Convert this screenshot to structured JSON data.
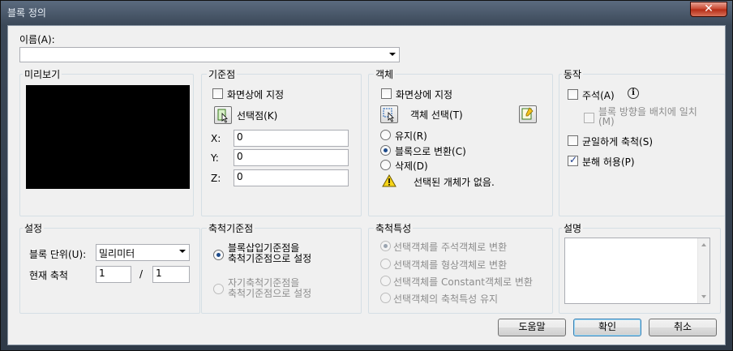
{
  "window": {
    "title": "블록 정의",
    "close_glyph": "✕"
  },
  "name": {
    "label": "이름(A):",
    "value": ""
  },
  "preview": {
    "title": "미리보기"
  },
  "base_point": {
    "title": "기준점",
    "specify_on_screen": "화면상에 지정",
    "pick_point": "선택점(K)",
    "x_label": "X:",
    "x_value": "0",
    "y_label": "Y:",
    "y_value": "0",
    "z_label": "Z:",
    "z_value": "0"
  },
  "objects": {
    "title": "객체",
    "specify_on_screen": "화면상에 지정",
    "select_objects": "객체 선택(T)",
    "retain": "유지(R)",
    "convert_to_block": "블록으로 변환(C)",
    "delete": "삭제(D)",
    "status": "선택된 개체가 없음."
  },
  "behavior": {
    "title": "동작",
    "annotative": "주석(A)",
    "match_orientation": "블록 방향을 배치에 일치",
    "match_orientation_suffix": "(M)",
    "scale_uniformly": "균일하게 축척(S)",
    "allow_exploding": "분해 허용(P)",
    "info_glyph": "i"
  },
  "settings": {
    "title": "설정",
    "block_unit_label": "블록 단위(U):",
    "block_unit_value": "밀리미터",
    "current_scale_label": "현재 축척",
    "scale_a": "1",
    "scale_sep": "/",
    "scale_b": "1"
  },
  "scale_base": {
    "title": "축척기준점",
    "opt1_line1": "블록삽입기준점을",
    "opt1_line2": "축척기준점으로 설정",
    "opt2_line1": "자기축척기준점을",
    "opt2_line2": "축척기준점으로 설정"
  },
  "scale_props": {
    "title": "축척특성",
    "opt1": "선택객체를 주석객체로 변환",
    "opt2": "선택객체를 형상객체로 변환",
    "opt3": "선택객체를 Constant객체로 변환",
    "opt4": "선택객체의 축척특성 유지"
  },
  "description": {
    "title": "설명",
    "value": ""
  },
  "buttons": {
    "help": "도움말",
    "ok": "확인",
    "cancel": "취소"
  }
}
